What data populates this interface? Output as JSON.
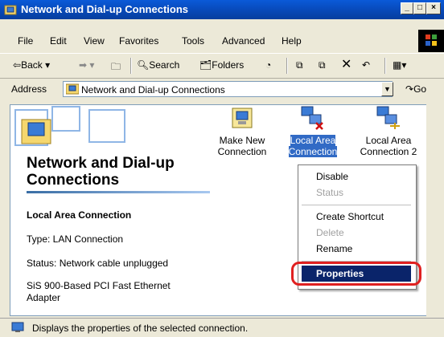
{
  "window": {
    "title": "Network and Dial-up Connections"
  },
  "menu": [
    "File",
    "Edit",
    "View",
    "Favorites",
    "Tools",
    "Advanced",
    "Help"
  ],
  "toolbar": {
    "back": "Back",
    "search": "Search",
    "folders": "Folders"
  },
  "address": {
    "label": "Address",
    "value": "Network and Dial-up Connections",
    "go": "Go"
  },
  "left_panel": {
    "title": "Network and Dial-up Connections",
    "selected_name": "Local Area Connection",
    "type": "Type: LAN Connection",
    "status": "Status: Network cable unplugged",
    "adapter": "SiS 900-Based PCI Fast Ethernet Adapter"
  },
  "icons": [
    {
      "label": "Make New Connection"
    },
    {
      "label": "Local Area Connection"
    },
    {
      "label": "Local Area Connection 2"
    }
  ],
  "context_menu": {
    "items": [
      "Disable",
      "Status",
      "Create Shortcut",
      "Delete",
      "Rename",
      "Properties"
    ],
    "disabled": [
      "Status",
      "Delete"
    ],
    "highlighted": "Properties"
  },
  "statusbar": {
    "text": "Displays the properties of the selected connection."
  },
  "colors": {
    "titlebar": "#0a5ad8",
    "highlight": "#0a246a",
    "annotation": "#e02020"
  }
}
